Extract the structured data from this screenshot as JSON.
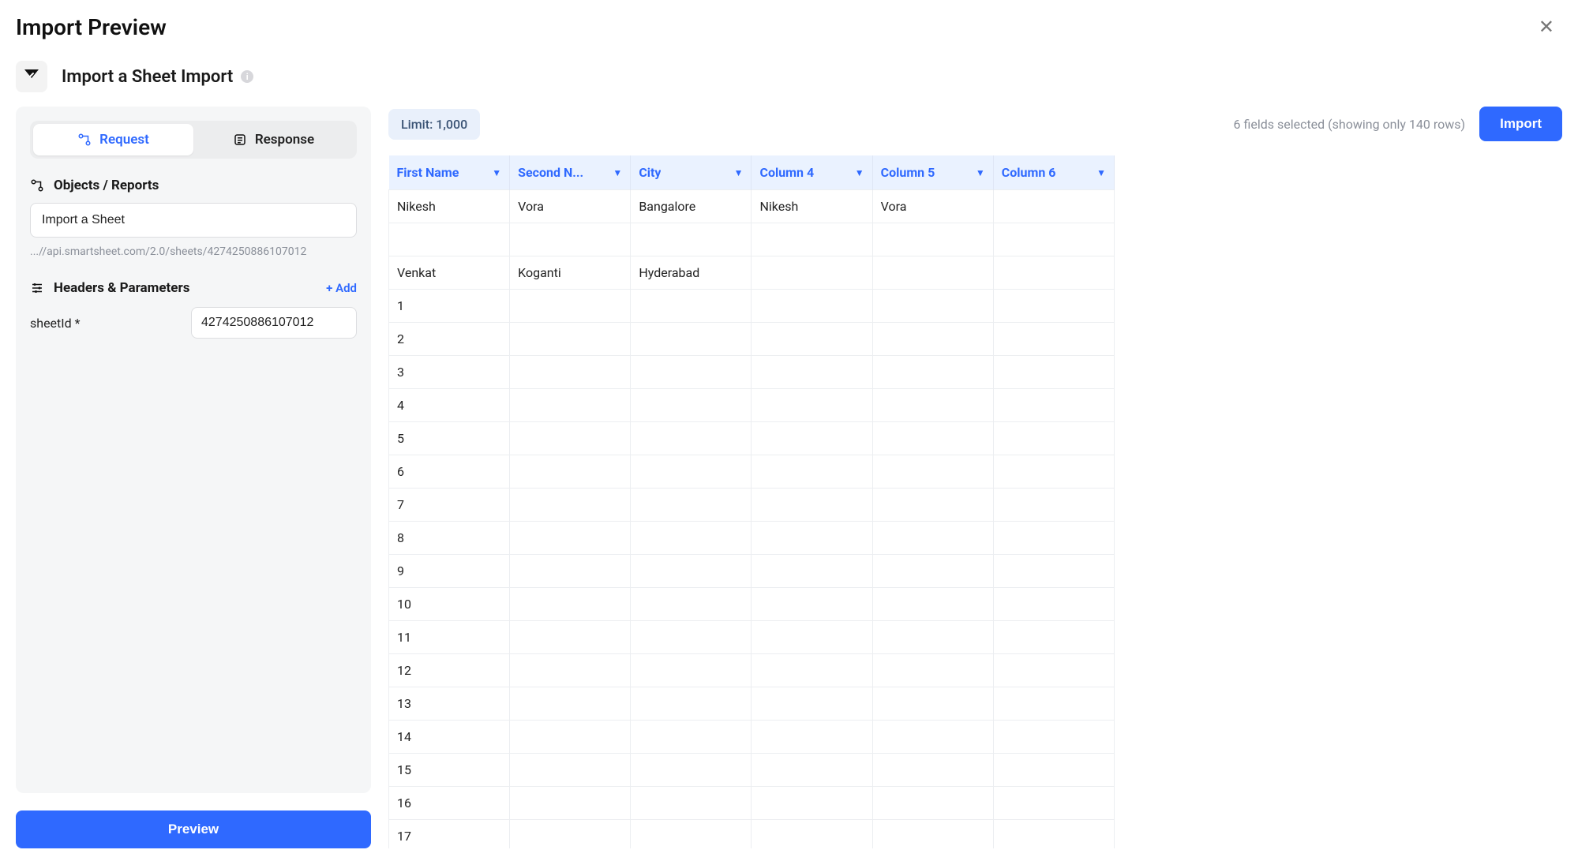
{
  "modal": {
    "title": "Import Preview",
    "close_glyph": "✕"
  },
  "subheader": {
    "title": "Import a Sheet Import",
    "limit_label": "Limit: 1,000",
    "fields_text": "6 fields selected (showing only 140 rows)",
    "import_button": "Import"
  },
  "sidebar": {
    "tabs": {
      "request": "Request",
      "response": "Response"
    },
    "objects_label": "Objects / Reports",
    "object_value": "Import a Sheet",
    "api_url": "...//api.smartsheet.com/2.0/sheets/4274250886107012",
    "headers_label": "Headers & Parameters",
    "add_label": "+ Add",
    "param_name": "sheetId *",
    "param_value": "4274250886107012",
    "preview_button": "Preview"
  },
  "table": {
    "columns": [
      "First Name",
      "Second N...",
      "City",
      "Column 4",
      "Column 5",
      "Column 6"
    ],
    "rows": [
      [
        "Nikesh",
        "Vora",
        "Bangalore",
        "Nikesh",
        "Vora",
        ""
      ],
      [
        "",
        "",
        "",
        "",
        "",
        ""
      ],
      [
        "Venkat",
        "Koganti",
        "Hyderabad",
        "",
        "",
        ""
      ],
      [
        "1",
        "",
        "",
        "",
        "",
        ""
      ],
      [
        "2",
        "",
        "",
        "",
        "",
        ""
      ],
      [
        "3",
        "",
        "",
        "",
        "",
        ""
      ],
      [
        "4",
        "",
        "",
        "",
        "",
        ""
      ],
      [
        "5",
        "",
        "",
        "",
        "",
        ""
      ],
      [
        "6",
        "",
        "",
        "",
        "",
        ""
      ],
      [
        "7",
        "",
        "",
        "",
        "",
        ""
      ],
      [
        "8",
        "",
        "",
        "",
        "",
        ""
      ],
      [
        "9",
        "",
        "",
        "",
        "",
        ""
      ],
      [
        "10",
        "",
        "",
        "",
        "",
        ""
      ],
      [
        "11",
        "",
        "",
        "",
        "",
        ""
      ],
      [
        "12",
        "",
        "",
        "",
        "",
        ""
      ],
      [
        "13",
        "",
        "",
        "",
        "",
        ""
      ],
      [
        "14",
        "",
        "",
        "",
        "",
        ""
      ],
      [
        "15",
        "",
        "",
        "",
        "",
        ""
      ],
      [
        "16",
        "",
        "",
        "",
        "",
        ""
      ],
      [
        "17",
        "",
        "",
        "",
        "",
        ""
      ]
    ]
  }
}
